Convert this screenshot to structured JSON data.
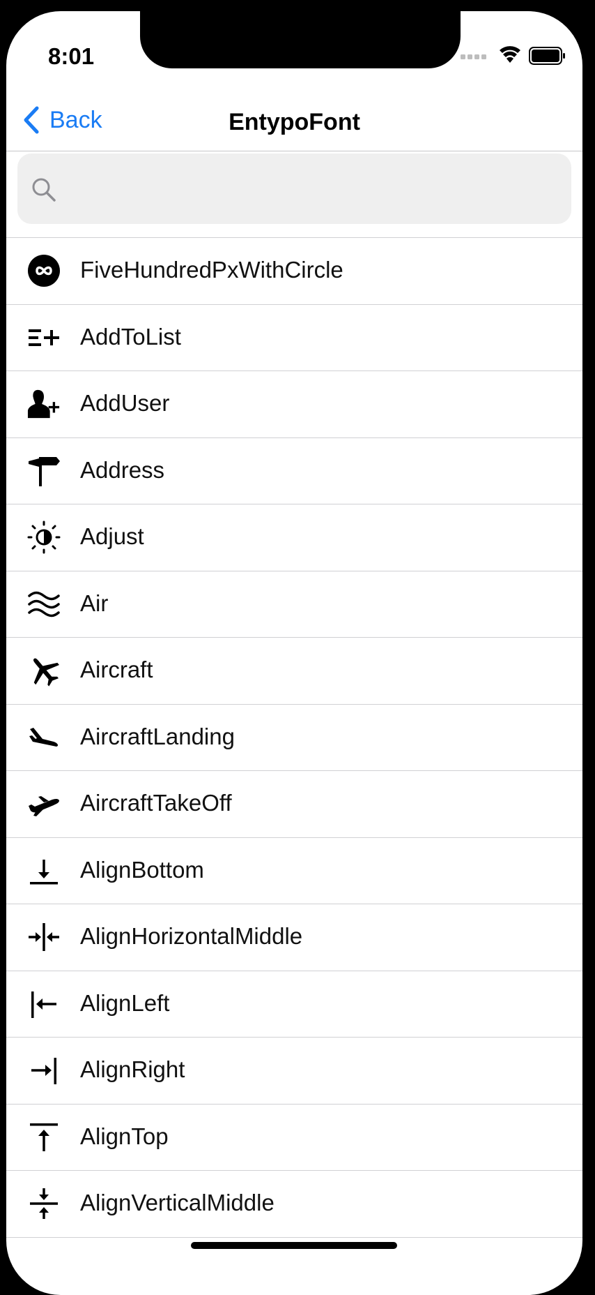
{
  "status": {
    "time": "8:01"
  },
  "nav": {
    "back_label": "Back",
    "title": "EntypoFont"
  },
  "search": {
    "placeholder": "",
    "value": ""
  },
  "items": [
    {
      "label": "FiveHundredPxWithCircle",
      "icon": "fivehundredpx-circle-icon"
    },
    {
      "label": "AddToList",
      "icon": "add-to-list-icon"
    },
    {
      "label": "AddUser",
      "icon": "add-user-icon"
    },
    {
      "label": "Address",
      "icon": "address-icon"
    },
    {
      "label": "Adjust",
      "icon": "adjust-icon"
    },
    {
      "label": "Air",
      "icon": "air-icon"
    },
    {
      "label": "Aircraft",
      "icon": "aircraft-icon"
    },
    {
      "label": "AircraftLanding",
      "icon": "aircraft-landing-icon"
    },
    {
      "label": "AircraftTakeOff",
      "icon": "aircraft-take-off-icon"
    },
    {
      "label": "AlignBottom",
      "icon": "align-bottom-icon"
    },
    {
      "label": "AlignHorizontalMiddle",
      "icon": "align-horizontal-middle-icon"
    },
    {
      "label": "AlignLeft",
      "icon": "align-left-icon"
    },
    {
      "label": "AlignRight",
      "icon": "align-right-icon"
    },
    {
      "label": "AlignTop",
      "icon": "align-top-icon"
    },
    {
      "label": "AlignVerticalMiddle",
      "icon": "align-vertical-middle-icon"
    }
  ],
  "colors": {
    "accent": "#1a7cf4",
    "separator": "#d0d0d3",
    "search_bg": "#efefef"
  }
}
